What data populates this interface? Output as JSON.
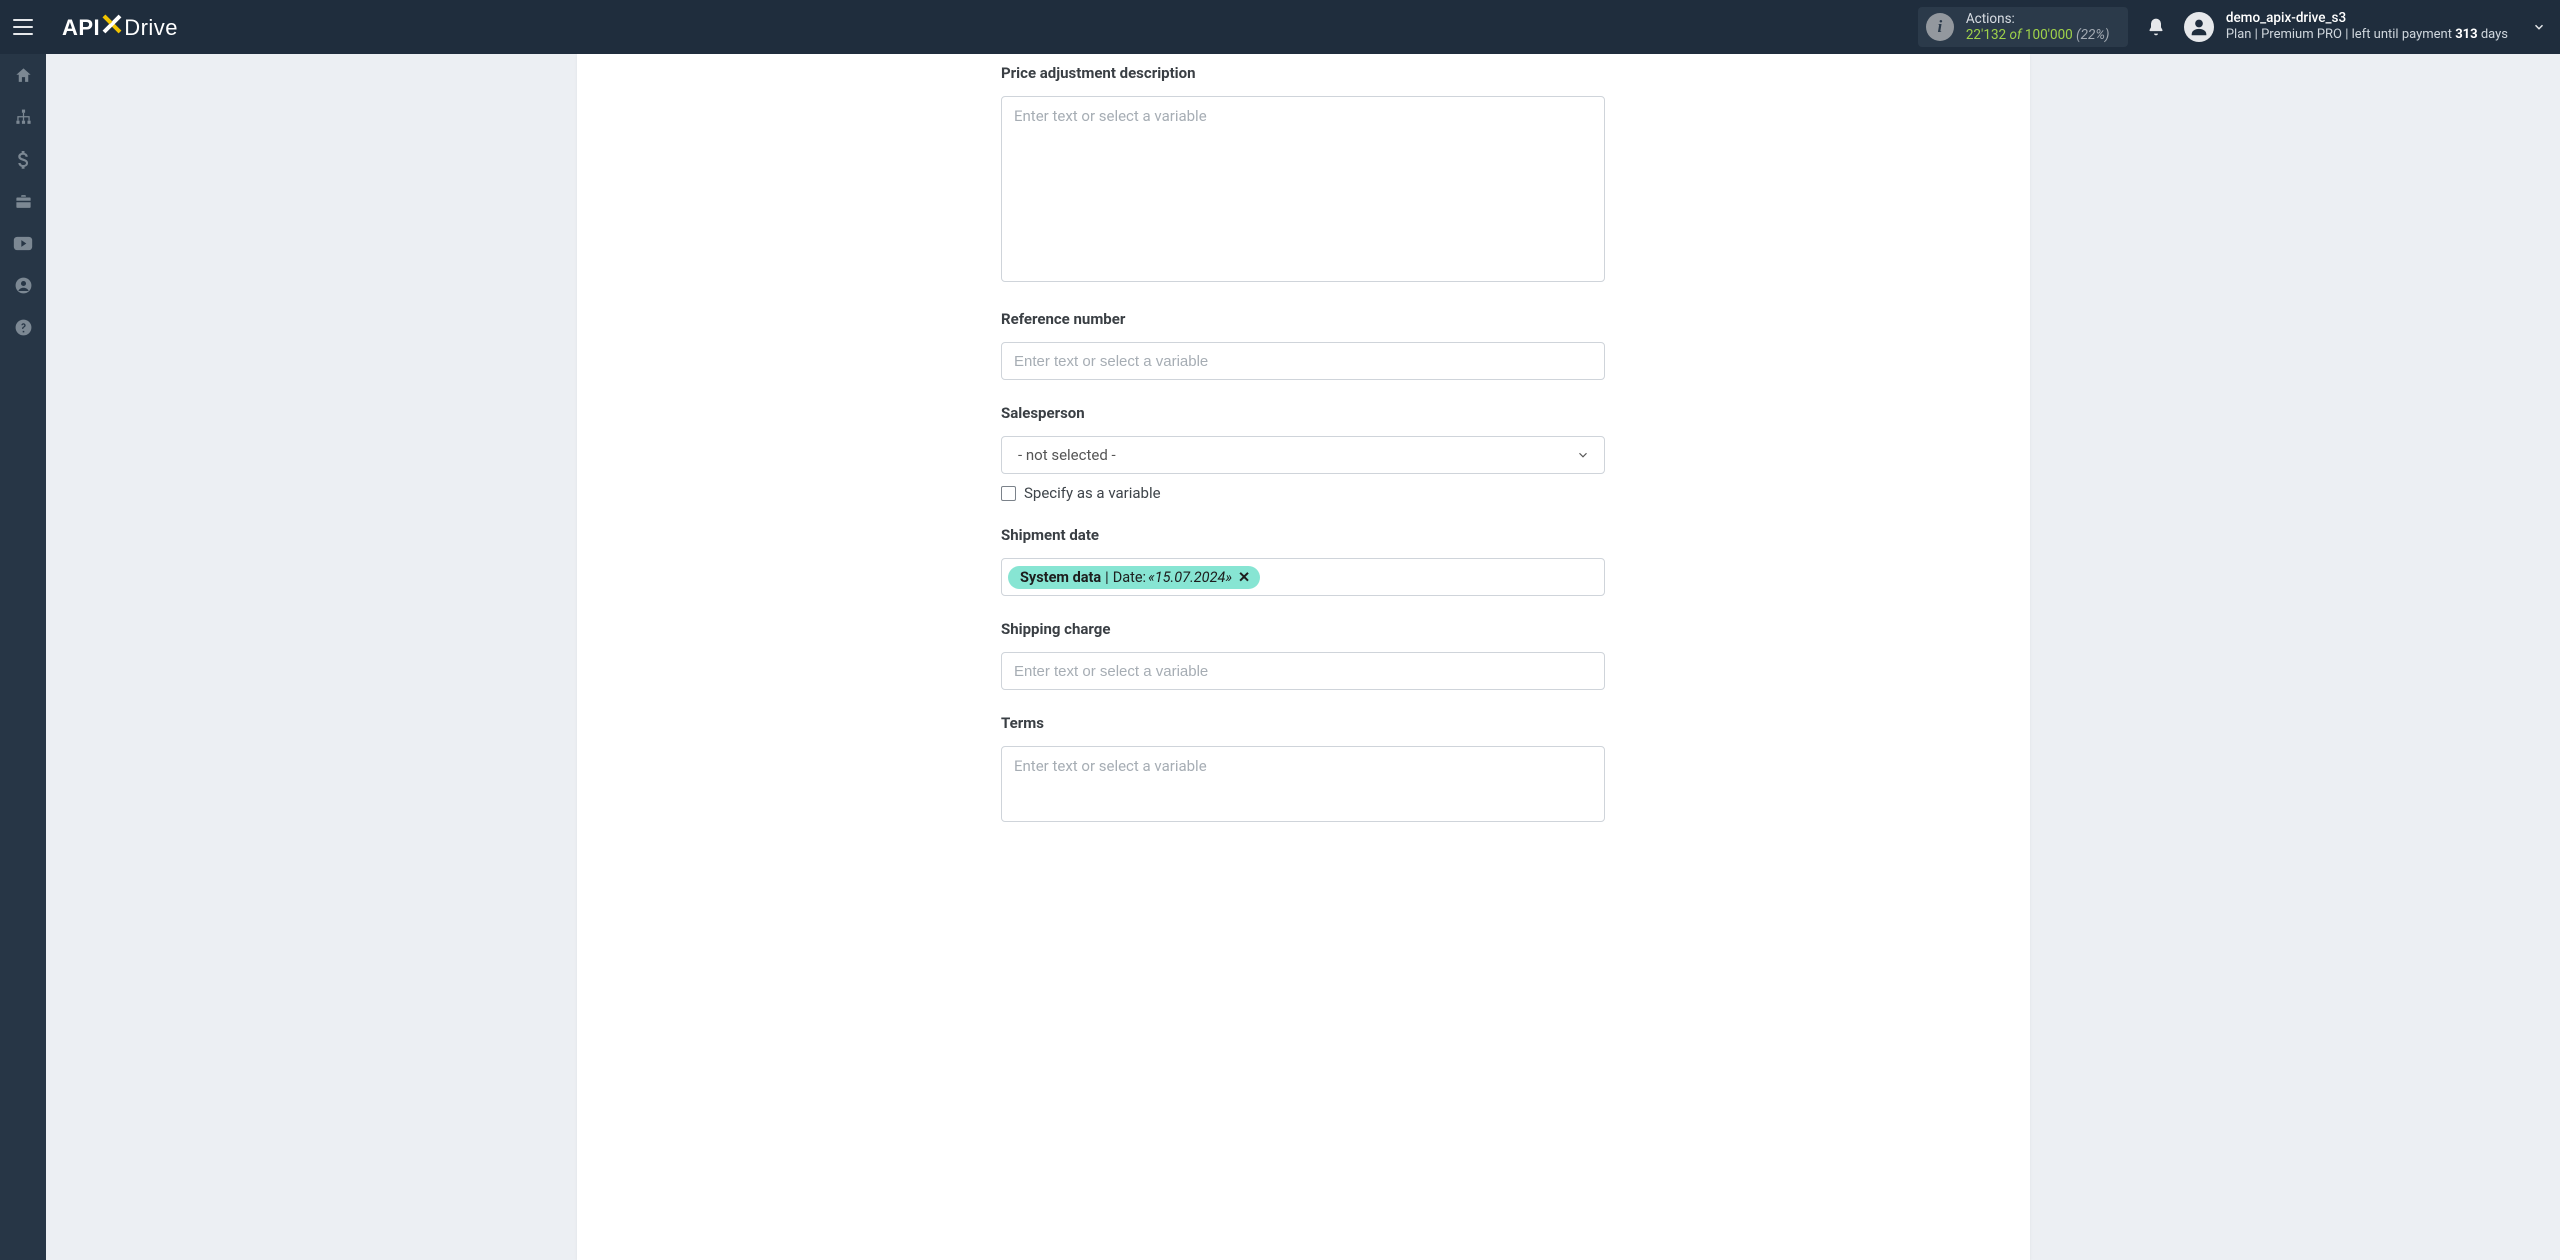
{
  "brand": {
    "part1": "API",
    "part2": "Drive"
  },
  "header": {
    "actions_label": "Actions:",
    "actions_used": "22'132",
    "actions_of": "of",
    "actions_total": "100'000",
    "actions_pct": "(22%)"
  },
  "user": {
    "name": "demo_apix-drive_s3",
    "plan_prefix": "Plan |",
    "plan_name": "Premium PRO",
    "plan_mid": "|  left until payment",
    "plan_days": "313",
    "plan_suffix": "days"
  },
  "form": {
    "placeholder": "Enter text or select a variable",
    "price_adj_desc_label": "Price adjustment description",
    "reference_number_label": "Reference number",
    "salesperson_label": "Salesperson",
    "salesperson_value": "- not selected -",
    "specify_variable_label": "Specify as a variable",
    "shipment_date_label": "Shipment date",
    "shipment_tag_source": "System data",
    "shipment_tag_sep": " | ",
    "shipment_tag_label": "Date: ",
    "shipment_tag_value": "«15.07.2024»",
    "shipping_charge_label": "Shipping charge",
    "terms_label": "Terms"
  }
}
